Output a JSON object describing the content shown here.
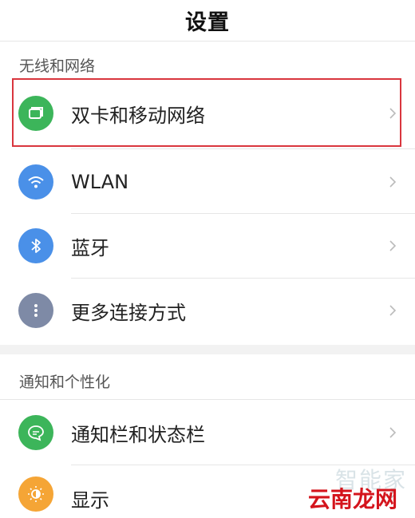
{
  "header": {
    "title": "设置"
  },
  "sections": [
    {
      "label": "无线和网络"
    },
    {
      "label": "通知和个性化"
    }
  ],
  "items": [
    {
      "label": "双卡和移动网络",
      "icon": "sim-card-icon",
      "color": "#3cb55a"
    },
    {
      "label": "WLAN",
      "icon": "wifi-icon",
      "color": "#4a90e8"
    },
    {
      "label": "蓝牙",
      "icon": "bluetooth-icon",
      "color": "#4a90e8"
    },
    {
      "label": "更多连接方式",
      "icon": "more-dots-icon",
      "color": "#7e8aa6"
    },
    {
      "label": "通知栏和状态栏",
      "icon": "message-icon",
      "color": "#3cb55a"
    },
    {
      "label": "显示",
      "icon": "brightness-icon",
      "color": "#f5a536"
    }
  ],
  "highlight_color": "#d9363e",
  "watermark": {
    "top_text": "智能家",
    "text": "云南龙网"
  }
}
